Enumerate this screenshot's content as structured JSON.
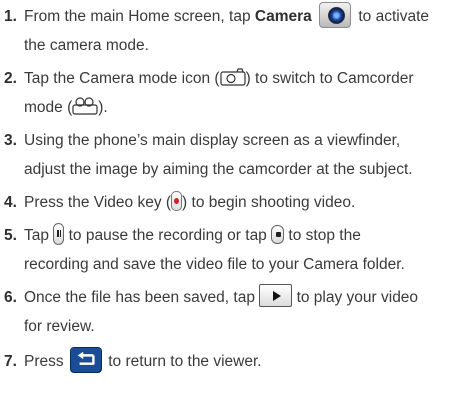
{
  "steps": [
    {
      "number": "1.",
      "line1_before": "From the main Home screen, tap ",
      "line1_bold": "Camera",
      "line1_after": " to activate",
      "line2": "the camera mode.",
      "icons": [
        "camera-app-icon"
      ]
    },
    {
      "number": "2.",
      "line1_before": "Tap the Camera mode icon (",
      "line1_after": ") to switch to Camcorder",
      "line2_before": "mode (",
      "line2_after": ").",
      "icons": [
        "camera-mode-icon",
        "camcorder-mode-icon"
      ]
    },
    {
      "number": "3.",
      "line1": "Using the phone’s main display screen as a viewfinder,",
      "line2": "adjust the image by aiming the camcorder at the subject."
    },
    {
      "number": "4.",
      "line1_before": "Press the Video key (",
      "line1_after": ") to begin shooting video.",
      "icons": [
        "video-key-icon"
      ]
    },
    {
      "number": "5.",
      "line1_before": "Tap ",
      "line1_middle": " to pause the recording or tap ",
      "line1_after": " to stop the",
      "line2": "recording and save the video file to your Camera folder.",
      "icons": [
        "pause-icon",
        "stop-icon"
      ]
    },
    {
      "number": "6.",
      "line1_before": "Once the file has been saved, tap ",
      "line1_after": " to play your video",
      "line2": "for review.",
      "icons": [
        "play-icon"
      ]
    },
    {
      "number": "7.",
      "line1_before": "Press ",
      "line1_after": " to return to the viewer.",
      "icons": [
        "back-icon"
      ]
    }
  ],
  "colors": {
    "text": "#3a3a3a",
    "video_key_red": "#d2202a",
    "back_button_blue": "#1a4d96",
    "camera_lens_blue": "#1e4fb0"
  }
}
